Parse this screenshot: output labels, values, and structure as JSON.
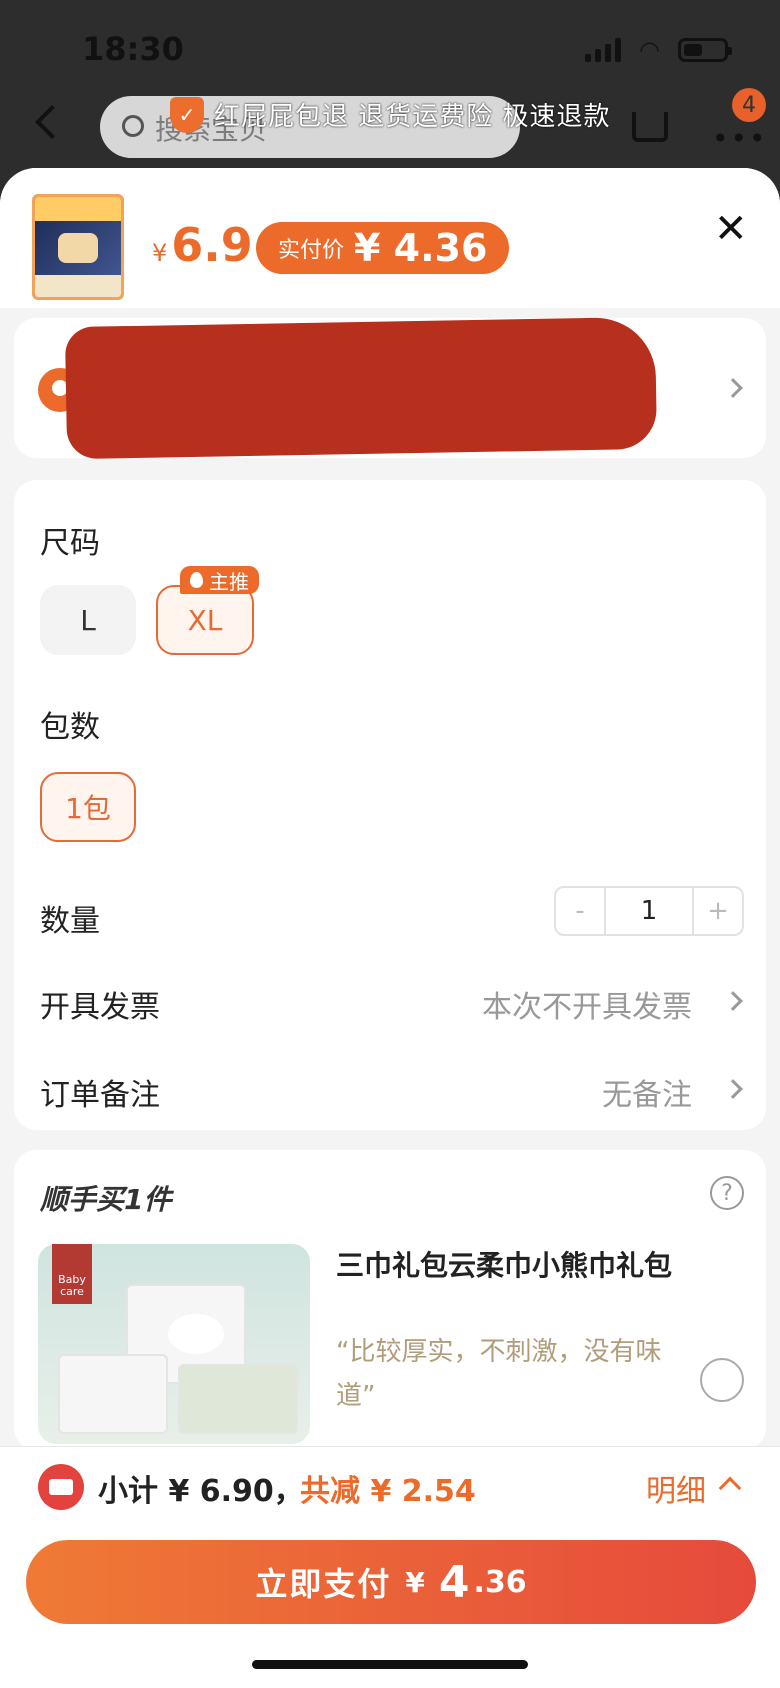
{
  "status_bar": {
    "time": "18:30"
  },
  "top_bar": {
    "search_placeholder": "搜索宝贝",
    "banner": "红屁屁包退 退货运费险 极速退款",
    "cart_badge": "4"
  },
  "product": {
    "currency": "¥",
    "price": "6.9",
    "real_price_label": "实付价",
    "real_price": "¥ 4.36"
  },
  "specs": {
    "size_title": "尺码",
    "sizes": [
      "L",
      "XL"
    ],
    "selected_size": "XL",
    "hot_tag": "主推",
    "pack_title": "包数",
    "packs": [
      "1包"
    ],
    "qty_title": "数量",
    "qty": "1",
    "minus": "-",
    "plus": "+",
    "invoice_title": "开具发票",
    "invoice_value": "本次不开具发票",
    "note_title": "订单备注",
    "note_value": "无备注"
  },
  "addon": {
    "title": "顺手买1件",
    "help": "?",
    "brand": "Baby care",
    "name": "三巾礼包云柔巾小熊巾礼包",
    "quote": "“比较厚实，不刺激，没有味道”"
  },
  "footer": {
    "subtotal": "小计 ¥ 6.90，",
    "discount": "共减 ¥ 2.54",
    "detail": "明细",
    "pay_label": "立即支付",
    "pay_currency": "¥",
    "pay_big": "4",
    "pay_small": ".36"
  },
  "colors": {
    "accent": "#ec6a2a",
    "redact": "#b6301d"
  }
}
